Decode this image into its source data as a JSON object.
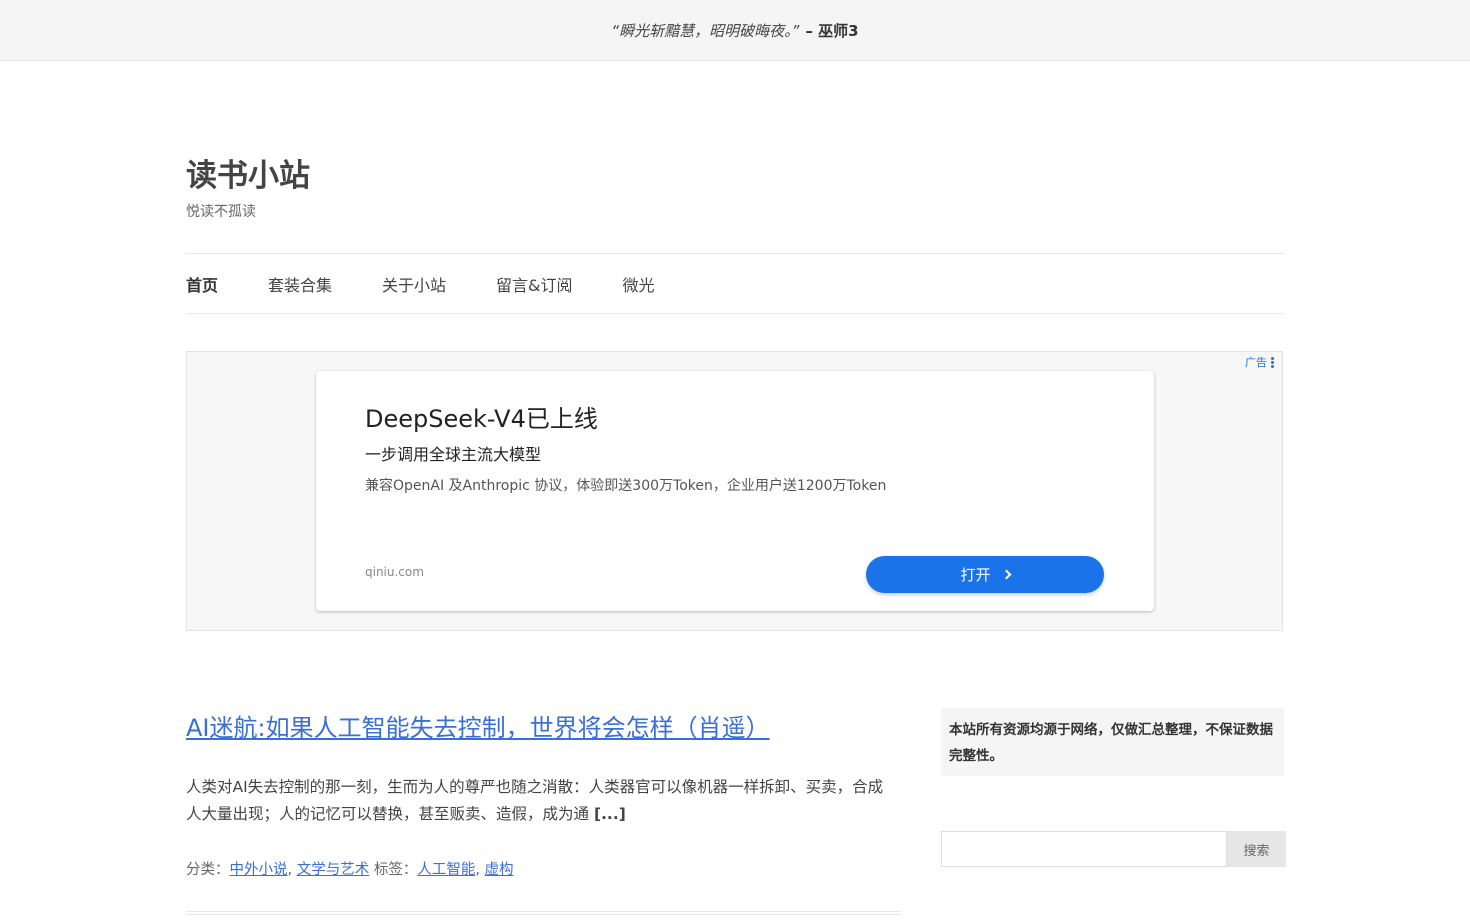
{
  "topbar": {
    "quote": "“瞬光斩黯慧，昭明破晦夜。”",
    "author": "– 巫师3"
  },
  "site": {
    "title": "读书小站",
    "description": "悦读不孤读"
  },
  "nav": {
    "items": [
      {
        "label": "首页",
        "current": true
      },
      {
        "label": "套装合集"
      },
      {
        "label": "关于小站"
      },
      {
        "label": "留言&订阅"
      },
      {
        "label": "微光"
      }
    ]
  },
  "ad": {
    "tag": "广告",
    "title": "DeepSeek-V4已上线",
    "subtitle": "一步调用全球主流大模型",
    "body": "兼容OpenAI 及Anthropic 协议，体验即送300万Token，企业用户送1200万Token",
    "domain": "qiniu.com",
    "button": "打开",
    "accent": "#1a73e8"
  },
  "post": {
    "title": "AI迷航:如果人工智能失去控制，世界将会怎样（肖遥）",
    "excerpt": "人类对AI失去控制的那一刻，生而为人的尊严也随之消散：人类器官可以像机器一样拆卸、买卖，合成人大量出现；人的记忆可以替换，甚至贩卖、造假，成为通",
    "more": "[...]",
    "category_label": "分类：",
    "categories": [
      "中外小说",
      "文学与艺术"
    ],
    "tag_label": "标签：",
    "tags": [
      "人工智能",
      "虚构"
    ],
    "link_color": "#3a6fd8"
  },
  "sidebar": {
    "notice": "本站所有资源均源于网络，仅做汇总整理，不保证数据完整性。",
    "search_button": "搜索",
    "search_value": ""
  }
}
